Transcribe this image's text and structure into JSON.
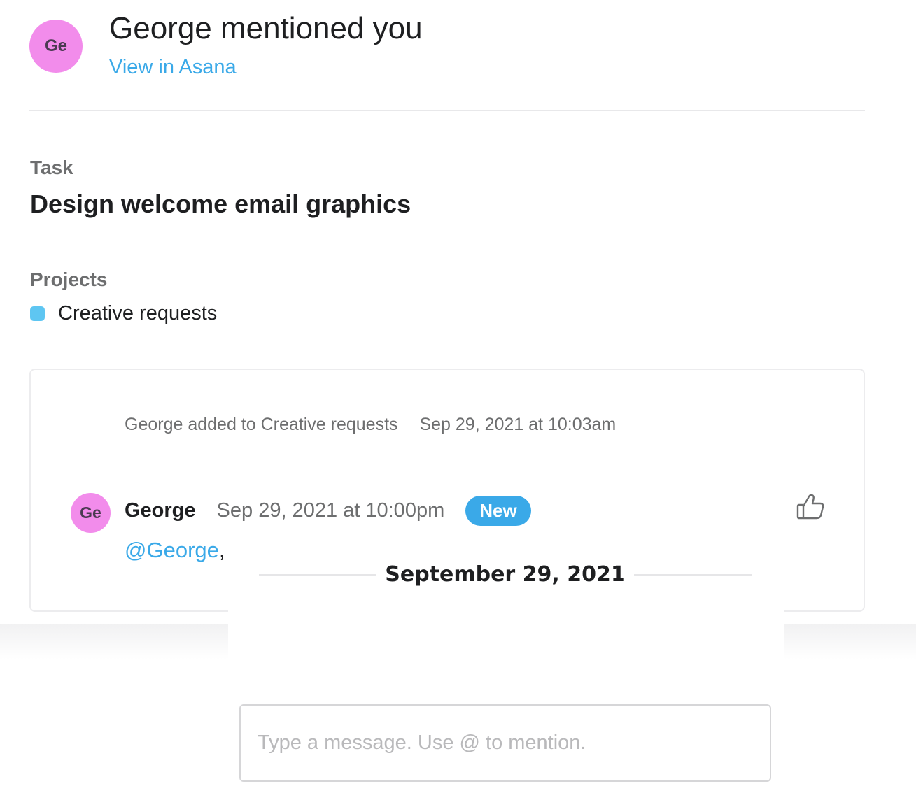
{
  "header": {
    "avatar_initials": "Ge",
    "title": "George mentioned you",
    "link_label": "View in Asana"
  },
  "task": {
    "label": "Task",
    "name": "Design welcome email graphics"
  },
  "projects": {
    "label": "Projects",
    "items": [
      {
        "name": "Creative requests",
        "color": "#5ec6f2"
      }
    ]
  },
  "activity": {
    "story_text": "George added to Creative requests",
    "story_time": "Sep 29, 2021 at 10:03am",
    "comment": {
      "avatar_initials": "Ge",
      "author": "George",
      "time": "Sep 29, 2021 at 10:00pm",
      "badge": "New",
      "mention": "@George",
      "text_after_mention": ",",
      "like_icon": "thumbs-up-icon"
    }
  },
  "chat": {
    "date_separator": "September 29, 2021",
    "input_placeholder": "Type a message. Use @ to mention."
  },
  "colors": {
    "accent": "#3aa9e8",
    "avatar": "#f28ceb",
    "muted_text": "#6d6e6f"
  }
}
